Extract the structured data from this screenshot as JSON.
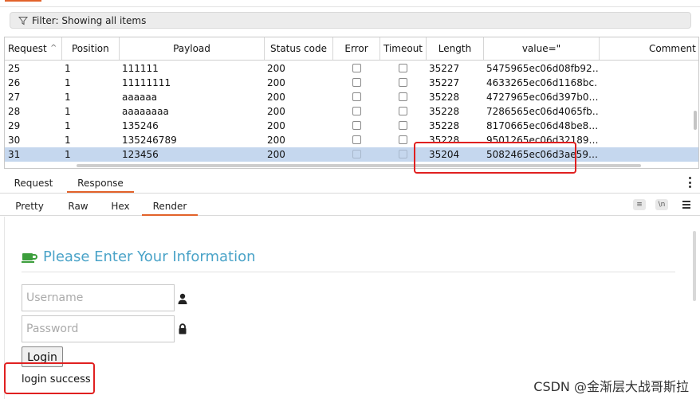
{
  "filter": {
    "text": "Filter: Showing all items"
  },
  "table": {
    "headers": [
      "Request",
      "Position",
      "Payload",
      "Status code",
      "Error",
      "Timeout",
      "Length",
      "value=\"",
      "Comment"
    ],
    "sort_indicator": "^",
    "rows": [
      {
        "request": "25",
        "position": "1",
        "payload": "111111",
        "status": "200",
        "length": "35227",
        "value": "5475965ec06d08fb92…",
        "selected": false
      },
      {
        "request": "26",
        "position": "1",
        "payload": "11111111",
        "status": "200",
        "length": "35227",
        "value": "4633265ec06d1168bc…",
        "selected": false
      },
      {
        "request": "27",
        "position": "1",
        "payload": "aaaaaa",
        "status": "200",
        "length": "35228",
        "value": "4727965ec06d397b0…",
        "selected": false
      },
      {
        "request": "28",
        "position": "1",
        "payload": "aaaaaaaa",
        "status": "200",
        "length": "35228",
        "value": "7286565ec06d4065fb…",
        "selected": false
      },
      {
        "request": "29",
        "position": "1",
        "payload": "135246",
        "status": "200",
        "length": "35228",
        "value": "8170665ec06d48be8…",
        "selected": false
      },
      {
        "request": "30",
        "position": "1",
        "payload": "135246789",
        "status": "200",
        "length": "35228",
        "value": "9501265ec06d32189…",
        "selected": false
      },
      {
        "request": "31",
        "position": "1",
        "payload": "123456",
        "status": "200",
        "length": "35204",
        "value": "5082465ec06d3ae59…",
        "selected": true
      }
    ]
  },
  "message_tabs": {
    "items": [
      "Request",
      "Response"
    ],
    "active": "Response"
  },
  "view_tabs": {
    "items": [
      "Pretty",
      "Raw",
      "Hex",
      "Render"
    ],
    "active": "Render",
    "newline_toggle": "\\n"
  },
  "render": {
    "heading": "Please Enter Your Information",
    "username_placeholder": "Username",
    "password_placeholder": "Password",
    "login_button": "Login",
    "message": "login success"
  },
  "watermark": "CSDN @金渐层大战哥斯拉",
  "colors": {
    "accent": "#e2622a",
    "selection": "#c5d7ee",
    "annotation": "#e02020",
    "heading": "#4aa3c8",
    "cup": "#3c9e3c"
  }
}
